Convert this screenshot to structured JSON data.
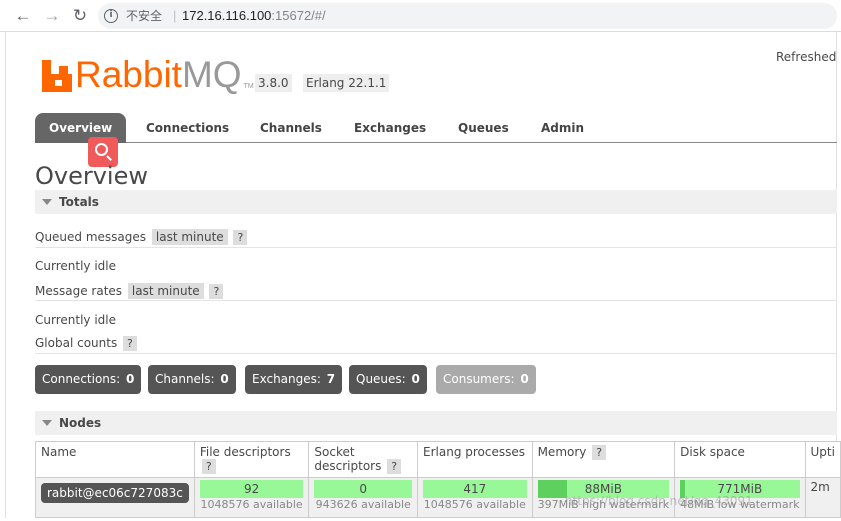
{
  "browser": {
    "security_label": "不安全",
    "url_host": "172.16.116.100",
    "url_rest": ":15672/#/"
  },
  "header": {
    "logo_rabbit": "Rabbit",
    "logo_mq": "MQ",
    "logo_tm": "TM",
    "version": "3.8.0",
    "erlang": "Erlang 22.1.1",
    "refreshed": "Refreshed"
  },
  "tabs": [
    {
      "label": "Overview"
    },
    {
      "label": "Connections"
    },
    {
      "label": "Channels"
    },
    {
      "label": "Exchanges"
    },
    {
      "label": "Queues"
    },
    {
      "label": "Admin"
    }
  ],
  "page_title": "Overview",
  "totals": {
    "heading": "Totals",
    "queued_label": "Queued messages",
    "queued_period": "last minute",
    "queued_help": "?",
    "queued_status": "Currently idle",
    "rates_label": "Message rates",
    "rates_period": "last minute",
    "rates_help": "?",
    "rates_status": "Currently idle",
    "global_label": "Global counts",
    "global_help": "?"
  },
  "counts": [
    {
      "label": "Connections:",
      "value": "0"
    },
    {
      "label": "Channels:",
      "value": "0"
    },
    {
      "label": "Exchanges:",
      "value": "7"
    },
    {
      "label": "Queues:",
      "value": "0"
    },
    {
      "label": "Consumers:",
      "value": "0"
    }
  ],
  "nodes": {
    "heading": "Nodes",
    "columns": {
      "name": "Name",
      "fd": "File descriptors",
      "sd": "Socket descriptors",
      "ep": "Erlang processes",
      "mem": "Memory",
      "disk": "Disk space",
      "up": "Upti"
    },
    "help": "?",
    "row": {
      "name": "rabbit@ec06c727083c",
      "fd_used": "92",
      "fd_avail": "1048576 available",
      "sd_used": "0",
      "sd_avail": "943626 available",
      "ep_used": "417",
      "ep_avail": "1048576 available",
      "mem_used": "88MiB",
      "mem_avail": "397MiB high watermark",
      "mem_fraction": 0.22,
      "disk_used": "771MiB",
      "disk_avail": "48MiB low watermark",
      "uptime": "2m"
    }
  },
  "watermark": "https://blog.csdn.net/qq_43091"
}
